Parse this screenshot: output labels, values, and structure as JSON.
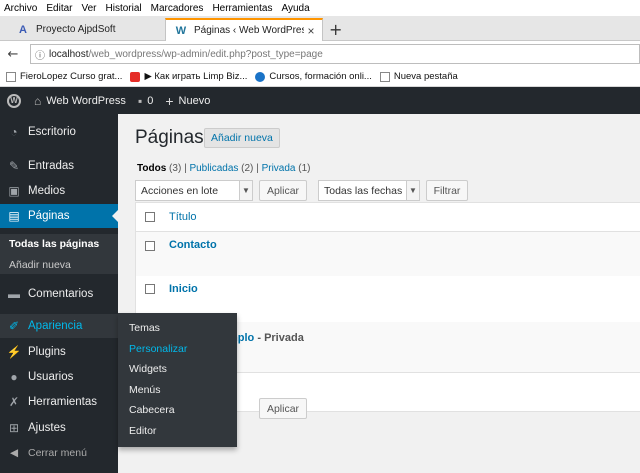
{
  "browser": {
    "menu": [
      "Archivo",
      "Editar",
      "Ver",
      "Historial",
      "Marcadores",
      "Herramientas",
      "Ayuda"
    ],
    "tabs": [
      {
        "title": "Proyecto AjpdSoft",
        "icon": "A"
      },
      {
        "title": "Páginas ‹ Web WordPress — WordPress",
        "icon": "W"
      }
    ],
    "new_tab": "+",
    "url_host": "localhost",
    "url_path": "/web_wordpress/wp-admin/edit.php?post_type=page",
    "bookmarks": [
      "FieroLopez Curso grat...",
      "▶ Как играть Limp Biz...",
      "Cursos, formación onli...",
      "Nueva pestaña"
    ]
  },
  "adminbar": {
    "site_name": "Web WordPress",
    "comments_count": "0",
    "new_label": "Nuevo"
  },
  "sidebar": {
    "items": [
      {
        "label": "Escritorio",
        "icon": "dashboard-icon"
      },
      {
        "label": "Entradas",
        "icon": "pin-icon"
      },
      {
        "label": "Medios",
        "icon": "media-icon"
      },
      {
        "label": "Páginas",
        "icon": "pages-icon"
      },
      {
        "label": "Comentarios",
        "icon": "comment-icon"
      },
      {
        "label": "Apariencia",
        "icon": "brush-icon"
      },
      {
        "label": "Plugins",
        "icon": "plugin-icon"
      },
      {
        "label": "Usuarios",
        "icon": "user-icon"
      },
      {
        "label": "Herramientas",
        "icon": "wrench-icon"
      },
      {
        "label": "Ajustes",
        "icon": "settings-icon"
      }
    ],
    "pages_submenu": [
      "Todas las páginas",
      "Añadir nueva"
    ],
    "collapse_label": "Cerrar menú"
  },
  "appearance_flyout": [
    "Temas",
    "Personalizar",
    "Widgets",
    "Menús",
    "Cabecera",
    "Editor"
  ],
  "main": {
    "heading": "Páginas",
    "add_new": "Añadir nueva",
    "views": [
      {
        "label": "Todos",
        "count": "(3)"
      },
      {
        "label": "Publicadas",
        "count": "(2)"
      },
      {
        "label": "Privada",
        "count": "(1)"
      }
    ],
    "bulk_actions": "Acciones en lote",
    "apply": "Aplicar",
    "dates_filter": "Todas las fechas",
    "filter": "Filtrar",
    "column_title": "Título",
    "rows": [
      {
        "title": "Contacto",
        "state": ""
      },
      {
        "title": "Inicio",
        "state": ""
      },
      {
        "title": "mplo",
        "state": "- Privada"
      }
    ]
  }
}
